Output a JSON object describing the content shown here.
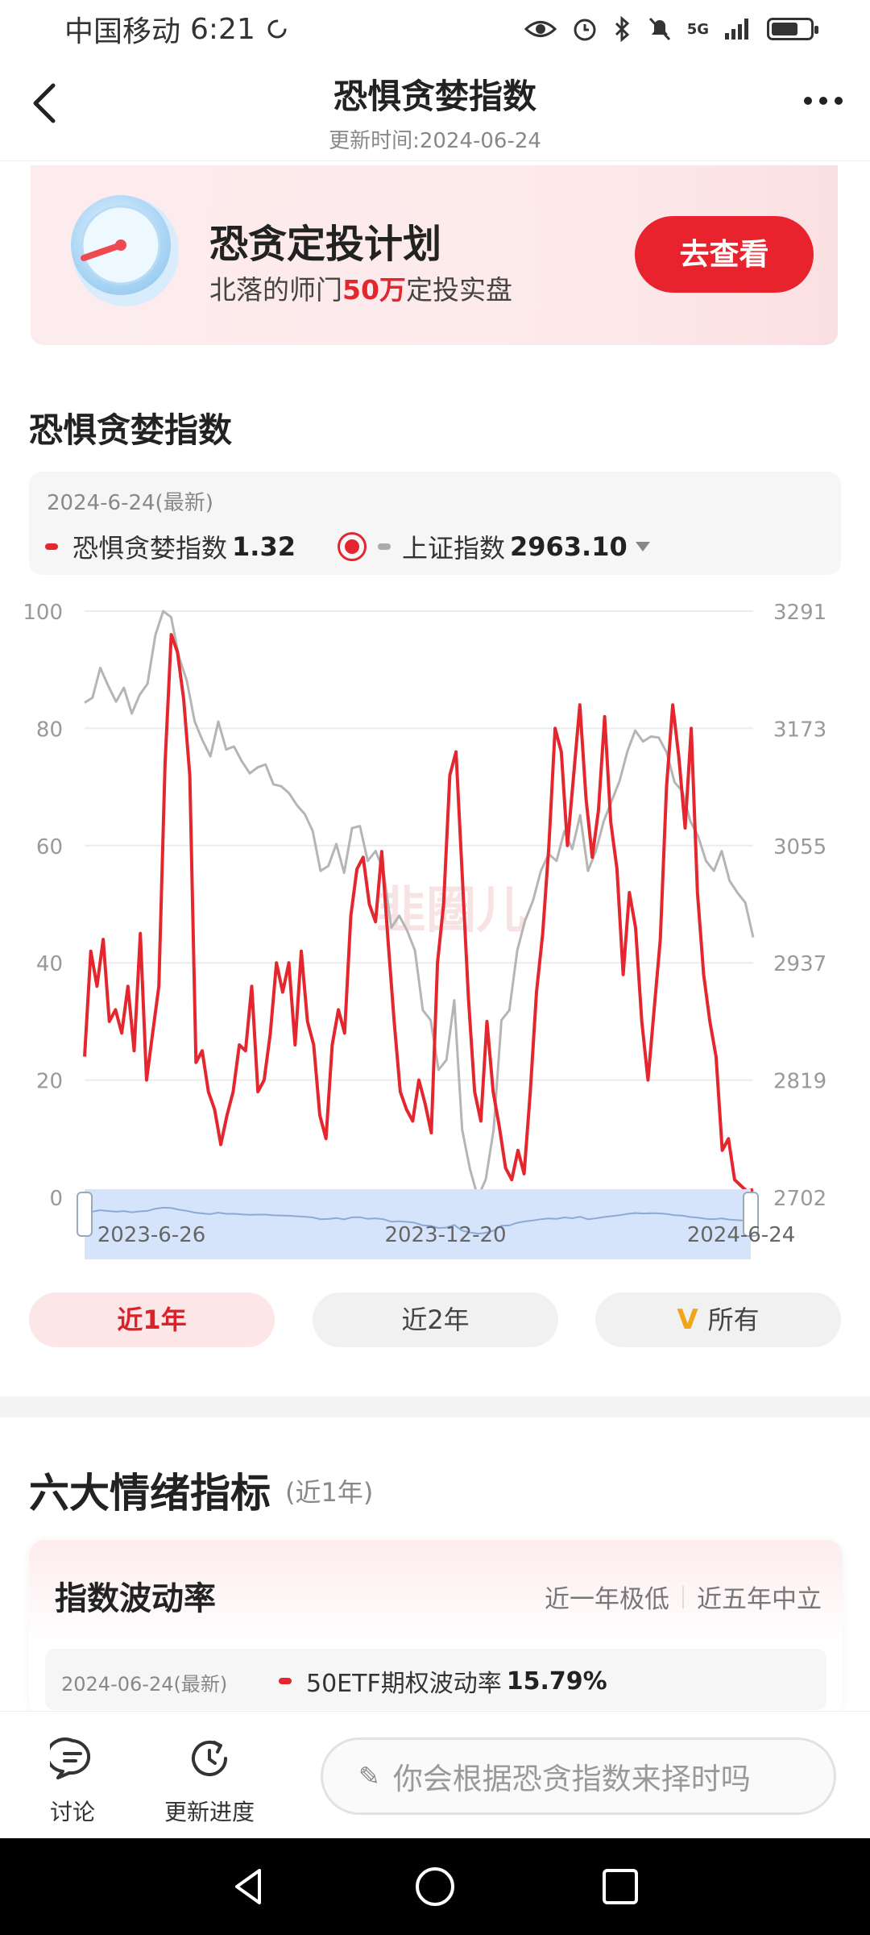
{
  "status_bar": {
    "carrier": "中国移动",
    "time": "6:21",
    "network": "5G"
  },
  "header": {
    "title": "恐惧贪婪指数",
    "subtitle": "更新时间:2024-06-24"
  },
  "banner": {
    "title": "恐贪定投计划",
    "subtitle_prefix": "北落的师门",
    "subtitle_highlight": "50万",
    "subtitle_suffix": "定投实盘",
    "button": "去查看"
  },
  "section_title": "恐惧贪婪指数",
  "legend": {
    "date": "2024-6-24(最新)",
    "series1_name": "恐惧贪婪指数",
    "series1_value": "1.32",
    "series2_name": "上证指数",
    "series2_value": "2963.10"
  },
  "chart_data": {
    "type": "line",
    "x_start": "2023-06-26",
    "x_end": "2024-06-24",
    "x_ticks": [
      "2023-6-26",
      "2023-12-20",
      "2024-6-24"
    ],
    "left_axis": {
      "ticks": [
        "100",
        "80",
        "60",
        "40",
        "20",
        "0"
      ],
      "ylim": [
        0,
        100
      ]
    },
    "right_axis": {
      "ticks": [
        "3291",
        "3173",
        "3055",
        "2937",
        "2819",
        "2702"
      ],
      "ylim": [
        2702,
        3291
      ]
    },
    "grid": true,
    "colors": {
      "fear_greed": "#e4262f",
      "sh_index": "#b5b5b5"
    },
    "series": [
      {
        "name": "恐惧贪婪指数",
        "axis": "left",
        "values": [
          24,
          42,
          36,
          44,
          30,
          32,
          28,
          36,
          25,
          45,
          20,
          28,
          36,
          74,
          96,
          93,
          85,
          72,
          23,
          25,
          18,
          15,
          9,
          14,
          18,
          26,
          25,
          36,
          18,
          20,
          28,
          40,
          35,
          40,
          26,
          42,
          30,
          26,
          14,
          10,
          26,
          32,
          28,
          48,
          56,
          58,
          50,
          47,
          59,
          44,
          30,
          18,
          15,
          13,
          20,
          16,
          11,
          40,
          50,
          72,
          76,
          55,
          34,
          18,
          13,
          30,
          18,
          12,
          5,
          3,
          8,
          4,
          18,
          35,
          45,
          60,
          80,
          76,
          60,
          72,
          84,
          68,
          58,
          66,
          82,
          64,
          56,
          38,
          52,
          46,
          30,
          20,
          32,
          44,
          70,
          84,
          75,
          63,
          80,
          52,
          38,
          30,
          24,
          8,
          10,
          3,
          2,
          1,
          1.32
        ]
      },
      {
        "name": "上证指数",
        "axis": "right",
        "values": [
          3199,
          3204,
          3234,
          3216,
          3200,
          3214,
          3188,
          3207,
          3218,
          3267,
          3291,
          3285,
          3245,
          3221,
          3180,
          3161,
          3145,
          3180,
          3152,
          3155,
          3140,
          3128,
          3134,
          3137,
          3117,
          3115,
          3108,
          3096,
          3087,
          3070,
          3030,
          3035,
          3057,
          3028,
          3073,
          3075,
          3040,
          3050,
          3030,
          2973,
          2985,
          2970,
          2950,
          2890,
          2880,
          2830,
          2840,
          2900,
          2770,
          2730,
          2702,
          2720,
          2770,
          2880,
          2890,
          2950,
          2980,
          3000,
          3030,
          3047,
          3040,
          3070,
          3052,
          3086,
          3030,
          3050,
          3080,
          3100,
          3120,
          3150,
          3171,
          3160,
          3165,
          3164,
          3149,
          3119,
          3110,
          3080,
          3065,
          3040,
          3030,
          3050,
          3020,
          3008,
          2998,
          2963.1
        ]
      }
    ]
  },
  "watermark": "韭圈儿",
  "range_buttons": [
    "近1年",
    "近2年",
    "所有"
  ],
  "six_indicators": {
    "title": "六大情绪指标",
    "subtitle": "(近1年)"
  },
  "volatility_card": {
    "title": "指数波动率",
    "tag1": "近一年极低",
    "tag2": "近五年中立",
    "date": "2024-06-24(最新)",
    "series_name": "50ETF期权波动率",
    "series_value": "15.79%"
  },
  "bottom_bar": {
    "discuss": "讨论",
    "progress": "更新进度",
    "ask_placeholder": "你会根据恐贪指数来择时吗"
  }
}
